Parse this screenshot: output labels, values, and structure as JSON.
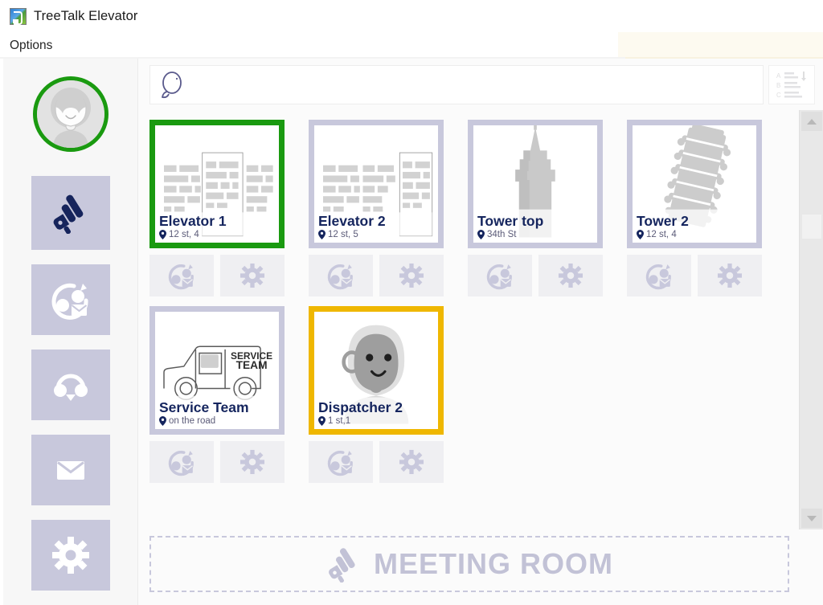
{
  "window": {
    "app_icon": "treetalk-app-icon",
    "title_brand": "TreeTalk",
    "title_module": "Elevator"
  },
  "menubar": {
    "options_label": "Options"
  },
  "sidebar": {
    "avatar": {
      "icon": "user-avatar-icon",
      "status_ring_color": "#1a9a10"
    },
    "items": [
      {
        "icon": "megaphone-icon",
        "name": "announcements"
      },
      {
        "icon": "callback-mail-icon",
        "name": "callback-messages"
      },
      {
        "icon": "headset-icon",
        "name": "headset-calls"
      },
      {
        "icon": "mail-icon",
        "name": "mailbox"
      },
      {
        "icon": "gear-icon",
        "name": "settings"
      }
    ]
  },
  "search": {
    "icon": "search-icon",
    "value": "",
    "placeholder": "",
    "sort_icon": "sort-alphabetical-icon",
    "sort_rows": [
      "A",
      "B",
      "C"
    ]
  },
  "cards": [
    {
      "title": "Elevator 1",
      "location": "12 st, 4",
      "state": "active",
      "border_color": "#1a9a10",
      "art": "city-buildings",
      "actions": [
        {
          "icon": "callback-mail-icon",
          "name": "callback"
        },
        {
          "icon": "gear-icon",
          "name": "settings"
        }
      ]
    },
    {
      "title": "Elevator 2",
      "location": "12 st, 5",
      "state": "idle",
      "border_color": "#c8c8dc",
      "art": "city-buildings",
      "actions": [
        {
          "icon": "callback-mail-icon",
          "name": "callback"
        },
        {
          "icon": "gear-icon",
          "name": "settings"
        }
      ]
    },
    {
      "title": "Tower top",
      "location": "34th St",
      "state": "idle",
      "border_color": "#c8c8dc",
      "art": "skyscraper-spire",
      "actions": [
        {
          "icon": "callback-mail-icon",
          "name": "callback"
        },
        {
          "icon": "gear-icon",
          "name": "settings"
        }
      ]
    },
    {
      "title": "Tower 2",
      "location": "12 st, 4",
      "state": "idle",
      "border_color": "#c8c8dc",
      "art": "leaning-tower",
      "actions": [
        {
          "icon": "callback-mail-icon",
          "name": "callback"
        },
        {
          "icon": "gear-icon",
          "name": "settings"
        }
      ]
    },
    {
      "title": "Service Team",
      "location": "on the road",
      "state": "idle",
      "border_color": "#c8c8dc",
      "art": "service-truck",
      "art_text_line1": "SERVICE",
      "art_text_line2": "TEAM",
      "actions": [
        {
          "icon": "callback-mail-icon",
          "name": "callback"
        },
        {
          "icon": "gear-icon",
          "name": "settings"
        }
      ]
    },
    {
      "title": "Dispatcher 2",
      "location": "1 st,1",
      "state": "warning",
      "border_color": "#efb700",
      "art": "person-avatar",
      "actions": [
        {
          "icon": "callback-mail-icon",
          "name": "callback"
        },
        {
          "icon": "gear-icon",
          "name": "settings"
        }
      ]
    }
  ],
  "scrollbar": {
    "up_icon": "chevron-up-icon",
    "down_icon": "chevron-down-icon",
    "orientation": "vertical"
  },
  "footer": {
    "icon": "megaphone-icon",
    "label": "MEETING ROOM"
  }
}
